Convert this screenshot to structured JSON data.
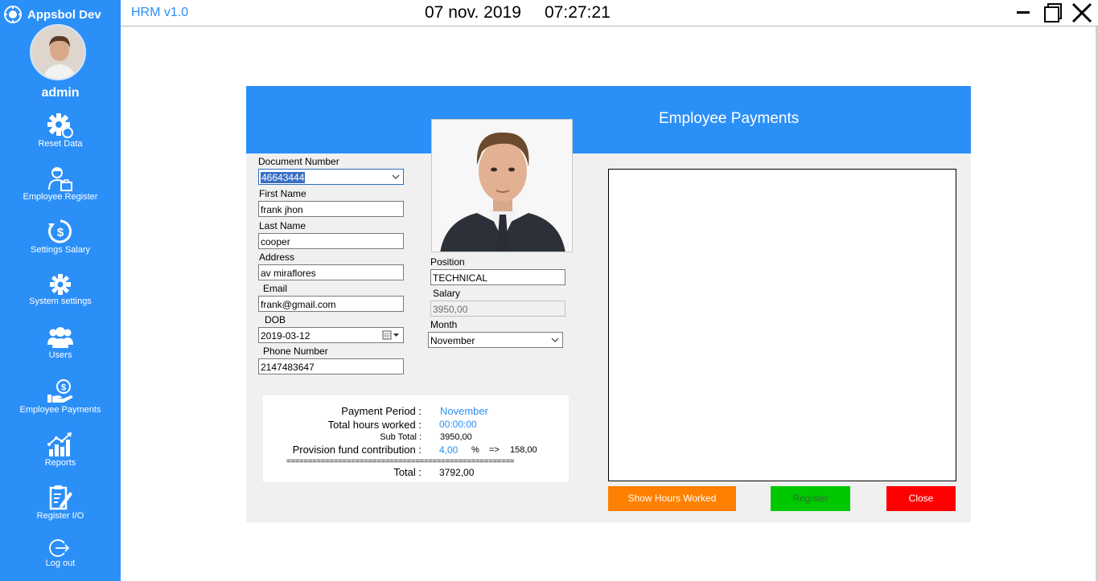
{
  "sidebar": {
    "brand": "Appsbol Dev",
    "user": "admin",
    "items": [
      {
        "label": "Reset Data",
        "icon": "gear-refresh-icon"
      },
      {
        "label": "Employee Register",
        "icon": "employee-icon"
      },
      {
        "label": "Settings Salary",
        "icon": "salary-settings-icon"
      },
      {
        "label": "System settings",
        "icon": "gear-icon"
      },
      {
        "label": "Users",
        "icon": "users-icon"
      },
      {
        "label": "Employee Payments",
        "icon": "payment-hand-icon"
      },
      {
        "label": "Reports",
        "icon": "bar-chart-icon"
      },
      {
        "label": "Register I/O",
        "icon": "clipboard-edit-icon"
      },
      {
        "label": "Log out",
        "icon": "logout-icon"
      }
    ]
  },
  "titlebar": {
    "app_title": "HRM v1.0",
    "date": "07 nov. 2019",
    "time": "07:27:21"
  },
  "panel": {
    "title": "Employee Payments"
  },
  "form": {
    "document_number": {
      "label": "Document Number",
      "value": "46643444"
    },
    "first_name": {
      "label": "First Name",
      "value": "frank jhon"
    },
    "last_name": {
      "label": "Last Name",
      "value": "cooper"
    },
    "address": {
      "label": "Address",
      "value": "av miraflores"
    },
    "email": {
      "label": "Email",
      "value": "frank@gmail.com"
    },
    "dob": {
      "label": "DOB",
      "value": "2019-03-12"
    },
    "phone": {
      "label": "Phone Number",
      "value": "2147483647"
    },
    "position": {
      "label": "Position",
      "value": "TECHNICAL"
    },
    "salary": {
      "label": "Salary",
      "value": "3950,00"
    },
    "month": {
      "label": "Month",
      "value": "November"
    }
  },
  "summary": {
    "payment_period_label": "Payment Period :",
    "payment_period_value": "November",
    "total_hours_label": "Total hours worked :",
    "total_hours_value": "00:00:00",
    "sub_total_label": "Sub Total :",
    "sub_total_value": "3950,00",
    "provision_label": "Provision fund contribution :",
    "provision_rate": "4,00",
    "percent_sign": "%",
    "arrow": "=>",
    "provision_amount": "158,00",
    "separator": "=====================================================",
    "total_label": "Total :",
    "total_value": "3792,00"
  },
  "buttons": {
    "show_hours": "Show Hours Worked",
    "register": "Register",
    "close": "Close"
  },
  "colors": {
    "accent": "#2b8ff8",
    "orange": "#ff8000",
    "green": "#00c800",
    "red": "#ff0000"
  }
}
